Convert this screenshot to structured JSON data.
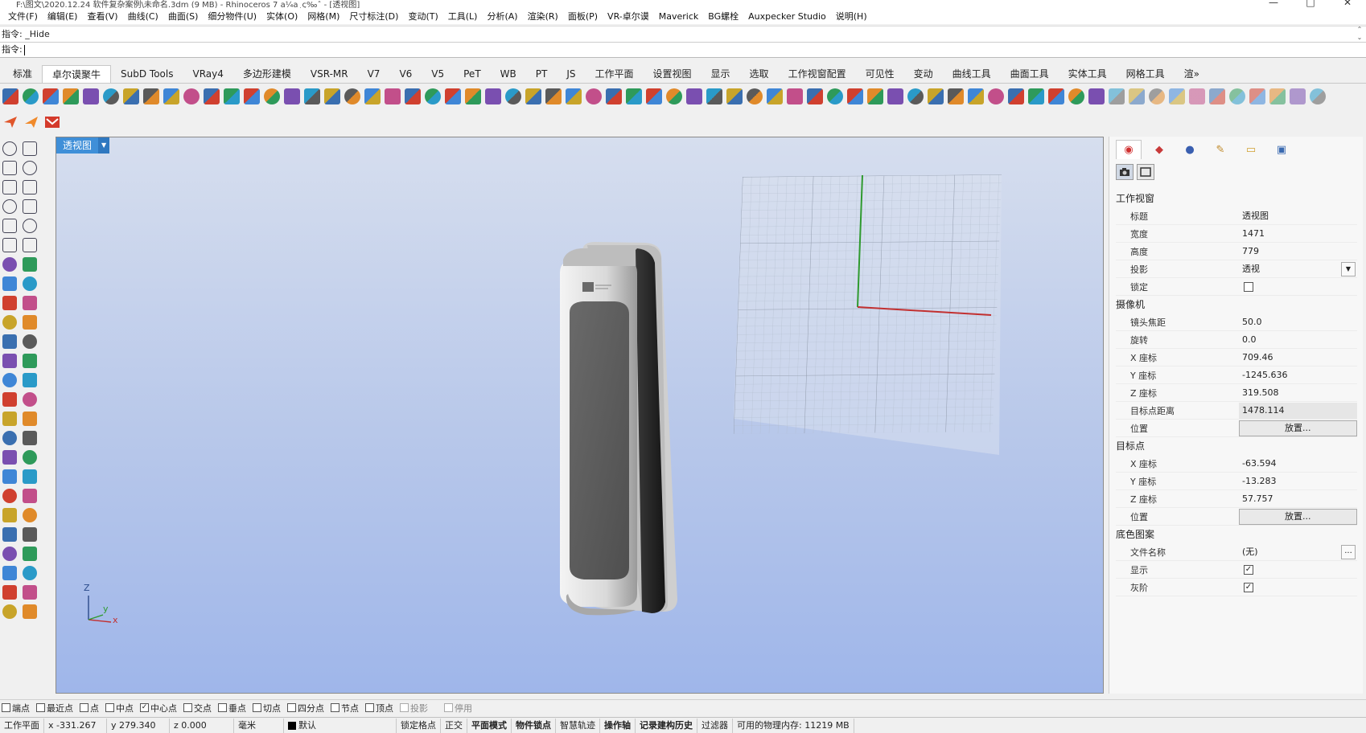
{
  "titlebar": {
    "title": "F:\\图文\\2020.12.24 软件复杂案例\\未命名.3dm (9 MB) - Rhinoceros 7 a¼a¸ç‰ˆ - [透视图]",
    "minimize": "—",
    "maximize": "□",
    "close": "✕"
  },
  "menu": [
    "文件(F)",
    "编辑(E)",
    "查看(V)",
    "曲线(C)",
    "曲面(S)",
    "细分物件(U)",
    "实体(O)",
    "网格(M)",
    "尺寸标注(D)",
    "变动(T)",
    "工具(L)",
    "分析(A)",
    "渲染(R)",
    "面板(P)",
    "VR-卓尔谟",
    "Maverick",
    "BG螺栓",
    "Auxpecker Studio",
    "说明(H)"
  ],
  "command": {
    "history": "指令: _Hide",
    "prompt": "指令:",
    "scroll_up": "⌃",
    "scroll_down": "⌄"
  },
  "tabs": [
    "标准",
    "卓尔谟聚牛",
    "SubD Tools",
    "VRay4",
    "多边形建模",
    "VSR-MR",
    "V7",
    "V6",
    "V5",
    "PeT",
    "WB",
    "PT",
    "JS",
    "工作平面",
    "设置视图",
    "显示",
    "选取",
    "工作视窗配置",
    "可见性",
    "变动",
    "曲线工具",
    "曲面工具",
    "实体工具",
    "网格工具",
    "渲»"
  ],
  "active_tab": "卓尔谟聚牛",
  "viewport": {
    "title": "透视图",
    "axis_z": "Z",
    "axis_y": "y",
    "axis_x": "x"
  },
  "panel": {
    "tab_icons": [
      "color-wheel-icon",
      "material-icon",
      "environment-icon",
      "light-icon",
      "folder-icon",
      "display-icon"
    ],
    "sections": [
      {
        "title": "工作视窗",
        "rows": [
          {
            "label": "标题",
            "value": "透视图",
            "type": "text"
          },
          {
            "label": "宽度",
            "value": "1471",
            "type": "text"
          },
          {
            "label": "高度",
            "value": "779",
            "type": "text"
          },
          {
            "label": "投影",
            "value": "透视",
            "type": "dropdown"
          },
          {
            "label": "锁定",
            "value": "",
            "type": "checkbox",
            "checked": false
          }
        ]
      },
      {
        "title": "摄像机",
        "rows": [
          {
            "label": "镜头焦距",
            "value": "50.0",
            "type": "text"
          },
          {
            "label": "旋转",
            "value": "0.0",
            "type": "text"
          },
          {
            "label": "X 座标",
            "value": "709.46",
            "type": "text"
          },
          {
            "label": "Y 座标",
            "value": "-1245.636",
            "type": "text"
          },
          {
            "label": "Z 座标",
            "value": "319.508",
            "type": "text"
          },
          {
            "label": "目标点距离",
            "value": "1478.114",
            "type": "shaded"
          },
          {
            "label": "位置",
            "value": "放置...",
            "type": "button"
          }
        ]
      },
      {
        "title": "目标点",
        "rows": [
          {
            "label": "X 座标",
            "value": "-63.594",
            "type": "text"
          },
          {
            "label": "Y 座标",
            "value": "-13.283",
            "type": "text"
          },
          {
            "label": "Z 座标",
            "value": "57.757",
            "type": "text"
          },
          {
            "label": "位置",
            "value": "放置...",
            "type": "button"
          }
        ]
      },
      {
        "title": "底色图案",
        "rows": [
          {
            "label": "文件名称",
            "value": "(无)",
            "type": "file"
          },
          {
            "label": "显示",
            "value": "",
            "type": "checkbox",
            "checked": true
          },
          {
            "label": "灰阶",
            "value": "",
            "type": "checkbox",
            "checked": true
          }
        ]
      }
    ]
  },
  "osnaps": [
    {
      "label": "端点",
      "checked": false,
      "disabled": false
    },
    {
      "label": "最近点",
      "checked": false,
      "disabled": false
    },
    {
      "label": "点",
      "checked": false,
      "disabled": false
    },
    {
      "label": "中点",
      "checked": false,
      "disabled": false
    },
    {
      "label": "中心点",
      "checked": true,
      "disabled": false
    },
    {
      "label": "交点",
      "checked": false,
      "disabled": false
    },
    {
      "label": "垂点",
      "checked": false,
      "disabled": false
    },
    {
      "label": "切点",
      "checked": false,
      "disabled": false
    },
    {
      "label": "四分点",
      "checked": false,
      "disabled": false
    },
    {
      "label": "节点",
      "checked": false,
      "disabled": false
    },
    {
      "label": "顶点",
      "checked": false,
      "disabled": false
    },
    {
      "label": "投影",
      "checked": false,
      "disabled": true
    },
    {
      "label": "停用",
      "checked": false,
      "disabled": true
    }
  ],
  "status": {
    "cplane": "工作平面",
    "x": "x -331.267",
    "y": "y 279.340",
    "z": "z 0.000",
    "units": "毫米",
    "layer": "默认",
    "toggles": [
      {
        "label": "锁定格点",
        "bold": false
      },
      {
        "label": "正交",
        "bold": false
      },
      {
        "label": "平面模式",
        "bold": true
      },
      {
        "label": "物件锁点",
        "bold": true
      },
      {
        "label": "智慧轨迹",
        "bold": false
      },
      {
        "label": "操作轴",
        "bold": true
      },
      {
        "label": "记录建构历史",
        "bold": true
      },
      {
        "label": "过滤器",
        "bold": false
      }
    ],
    "memory": "可用的物理内存: 11219 MB"
  },
  "colors": {
    "viewport_top": "#d6deee",
    "viewport_bottom": "#9fb6ea",
    "viewport_tab": "#3f8fd8",
    "axis_x": "#c23030",
    "axis_y": "#2f9a2f"
  }
}
